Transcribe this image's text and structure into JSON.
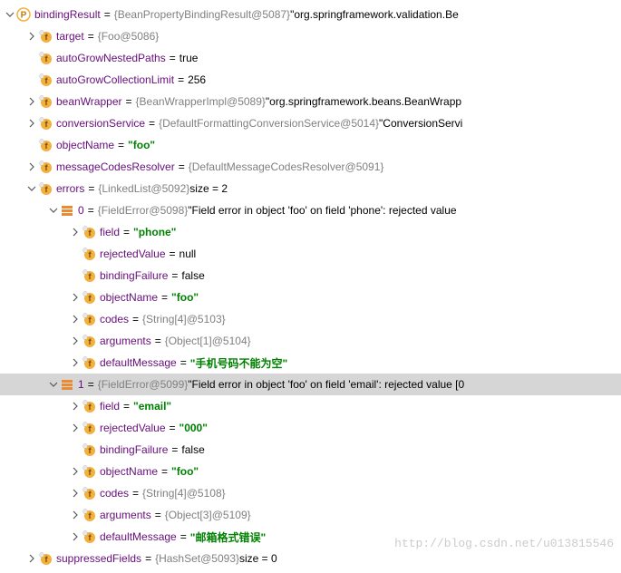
{
  "rows": [
    {
      "indent": 0,
      "arrow": "down",
      "icon": "p",
      "name": "bindingResult",
      "eq": "=",
      "gray": "{BeanPropertyBindingResult@5087}",
      "val": " \"org.springframework.validation.Be"
    },
    {
      "indent": 1,
      "arrow": "right",
      "icon": "f",
      "name": "target",
      "eq": "=",
      "gray": "{Foo@5086}"
    },
    {
      "indent": 1,
      "arrow": "none",
      "icon": "f",
      "name": "autoGrowNestedPaths",
      "eq": "=",
      "val": " true"
    },
    {
      "indent": 1,
      "arrow": "none",
      "icon": "f",
      "name": "autoGrowCollectionLimit",
      "eq": "=",
      "val": " 256"
    },
    {
      "indent": 1,
      "arrow": "right",
      "icon": "f",
      "name": "beanWrapper",
      "eq": "=",
      "gray": "{BeanWrapperImpl@5089}",
      "val": " \"org.springframework.beans.BeanWrapp"
    },
    {
      "indent": 1,
      "arrow": "right",
      "icon": "f",
      "name": "conversionService",
      "eq": "=",
      "gray": "{DefaultFormattingConversionService@5014}",
      "val": " \"ConversionServi"
    },
    {
      "indent": 1,
      "arrow": "none",
      "icon": "f",
      "name": "objectName",
      "eq": "=",
      "str": " \"foo\""
    },
    {
      "indent": 1,
      "arrow": "right",
      "icon": "f",
      "name": "messageCodesResolver",
      "eq": "=",
      "gray": "{DefaultMessageCodesResolver@5091}"
    },
    {
      "indent": 1,
      "arrow": "down",
      "icon": "f",
      "name": "errors",
      "eq": "=",
      "gray": "{LinkedList@5092}",
      "val": "  size = 2"
    },
    {
      "indent": 2,
      "arrow": "down",
      "icon": "e",
      "name": "0",
      "eq": "=",
      "gray": "{FieldError@5098}",
      "val": " \"Field error in object 'foo' on field 'phone': rejected value"
    },
    {
      "indent": 3,
      "arrow": "right",
      "icon": "f",
      "name": "field",
      "eq": "=",
      "str": " \"phone\""
    },
    {
      "indent": 3,
      "arrow": "none",
      "icon": "f",
      "name": "rejectedValue",
      "eq": "=",
      "val": " null"
    },
    {
      "indent": 3,
      "arrow": "none",
      "icon": "f",
      "name": "bindingFailure",
      "eq": "=",
      "val": " false"
    },
    {
      "indent": 3,
      "arrow": "right",
      "icon": "f",
      "name": "objectName",
      "eq": "=",
      "str": " \"foo\""
    },
    {
      "indent": 3,
      "arrow": "right",
      "icon": "f",
      "name": "codes",
      "eq": "=",
      "gray": "{String[4]@5103}"
    },
    {
      "indent": 3,
      "arrow": "right",
      "icon": "f",
      "name": "arguments",
      "eq": "=",
      "gray": "{Object[1]@5104}"
    },
    {
      "indent": 3,
      "arrow": "right",
      "icon": "f",
      "name": "defaultMessage",
      "eq": "=",
      "str": " \"手机号码不能为空\""
    },
    {
      "indent": 2,
      "arrow": "down",
      "icon": "e",
      "name": "1",
      "eq": "=",
      "gray": "{FieldError@5099}",
      "val": " \"Field error in object 'foo' on field 'email': rejected value [0",
      "selected": true
    },
    {
      "indent": 3,
      "arrow": "right",
      "icon": "f",
      "name": "field",
      "eq": "=",
      "str": " \"email\""
    },
    {
      "indent": 3,
      "arrow": "right",
      "icon": "f",
      "name": "rejectedValue",
      "eq": "=",
      "str": " \"000\""
    },
    {
      "indent": 3,
      "arrow": "none",
      "icon": "f",
      "name": "bindingFailure",
      "eq": "=",
      "val": " false"
    },
    {
      "indent": 3,
      "arrow": "right",
      "icon": "f",
      "name": "objectName",
      "eq": "=",
      "str": " \"foo\""
    },
    {
      "indent": 3,
      "arrow": "right",
      "icon": "f",
      "name": "codes",
      "eq": "=",
      "gray": "{String[4]@5108}"
    },
    {
      "indent": 3,
      "arrow": "right",
      "icon": "f",
      "name": "arguments",
      "eq": "=",
      "gray": "{Object[3]@5109}"
    },
    {
      "indent": 3,
      "arrow": "right",
      "icon": "f",
      "name": "defaultMessage",
      "eq": "=",
      "str": " \"邮箱格式错误\""
    },
    {
      "indent": 1,
      "arrow": "right",
      "icon": "f",
      "name": "suppressedFields",
      "eq": "=",
      "gray": "{HashSet@5093}",
      "val": "  size = 0"
    }
  ],
  "watermark": "http://blog.csdn.net/u013815546",
  "indent_step": 24,
  "base_indent": 4
}
